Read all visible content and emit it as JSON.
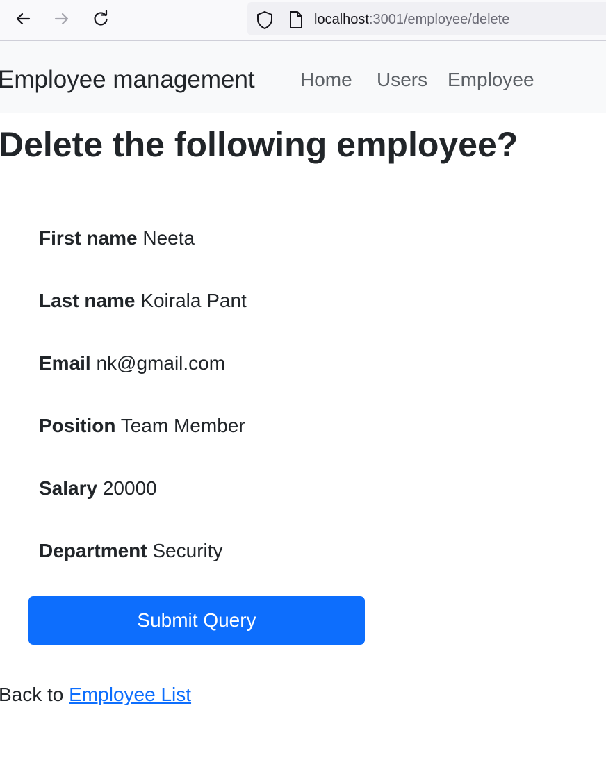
{
  "browser": {
    "url_host": "localhost",
    "url_path": ":3001/employee/delete",
    "icons": [
      "back-arrow-icon",
      "forward-arrow-icon",
      "reload-icon",
      "shield-icon",
      "page-icon"
    ]
  },
  "navbar": {
    "brand": "Employee management",
    "links": [
      {
        "label": "Home"
      },
      {
        "label": "Users"
      },
      {
        "label": "Employee"
      }
    ]
  },
  "main": {
    "title": "Delete the following employee?",
    "fields": [
      {
        "label": "First name",
        "value": "Neeta"
      },
      {
        "label": "Last name",
        "value": "Koirala Pant"
      },
      {
        "label": "Email",
        "value": "nk@gmail.com"
      },
      {
        "label": "Position",
        "value": "Team Member"
      },
      {
        "label": "Salary",
        "value": "20000"
      },
      {
        "label": "Department",
        "value": "Security"
      }
    ],
    "submit_label": "Submit Query",
    "back_prefix": "Back to ",
    "back_link": "Employee List"
  },
  "colors": {
    "primary": "#0d6efd",
    "navbar_bg": "#f8f9fa",
    "text": "#212529",
    "nav_link": "#5c6166"
  }
}
